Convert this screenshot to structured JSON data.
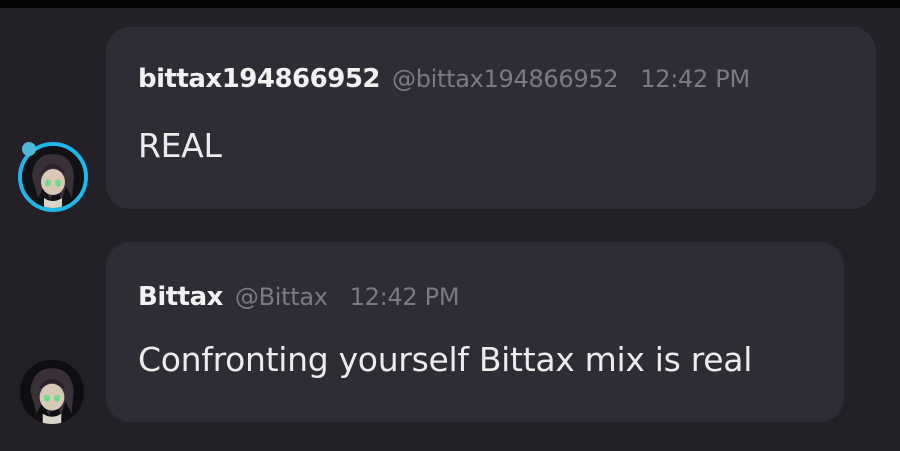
{
  "messages": [
    {
      "display_name": "bittax194866952",
      "handle": "@bittax194866952",
      "time": "12:42 PM",
      "text": "REAL",
      "avatar_icon": "anime-character-avatar-icon",
      "avatar_ring_color": "#1fb6e8"
    },
    {
      "display_name": "Bittax",
      "handle": "@Bittax",
      "time": "12:42 PM",
      "text": "Confronting yourself Bittax mix is real",
      "avatar_icon": "anime-character-avatar-icon"
    }
  ],
  "colors": {
    "background": "#232028",
    "bubble": "#2f2c35",
    "name": "#f2f2f2",
    "meta": "#7c7985",
    "text": "#ececec",
    "accent": "#1fb6e8"
  }
}
